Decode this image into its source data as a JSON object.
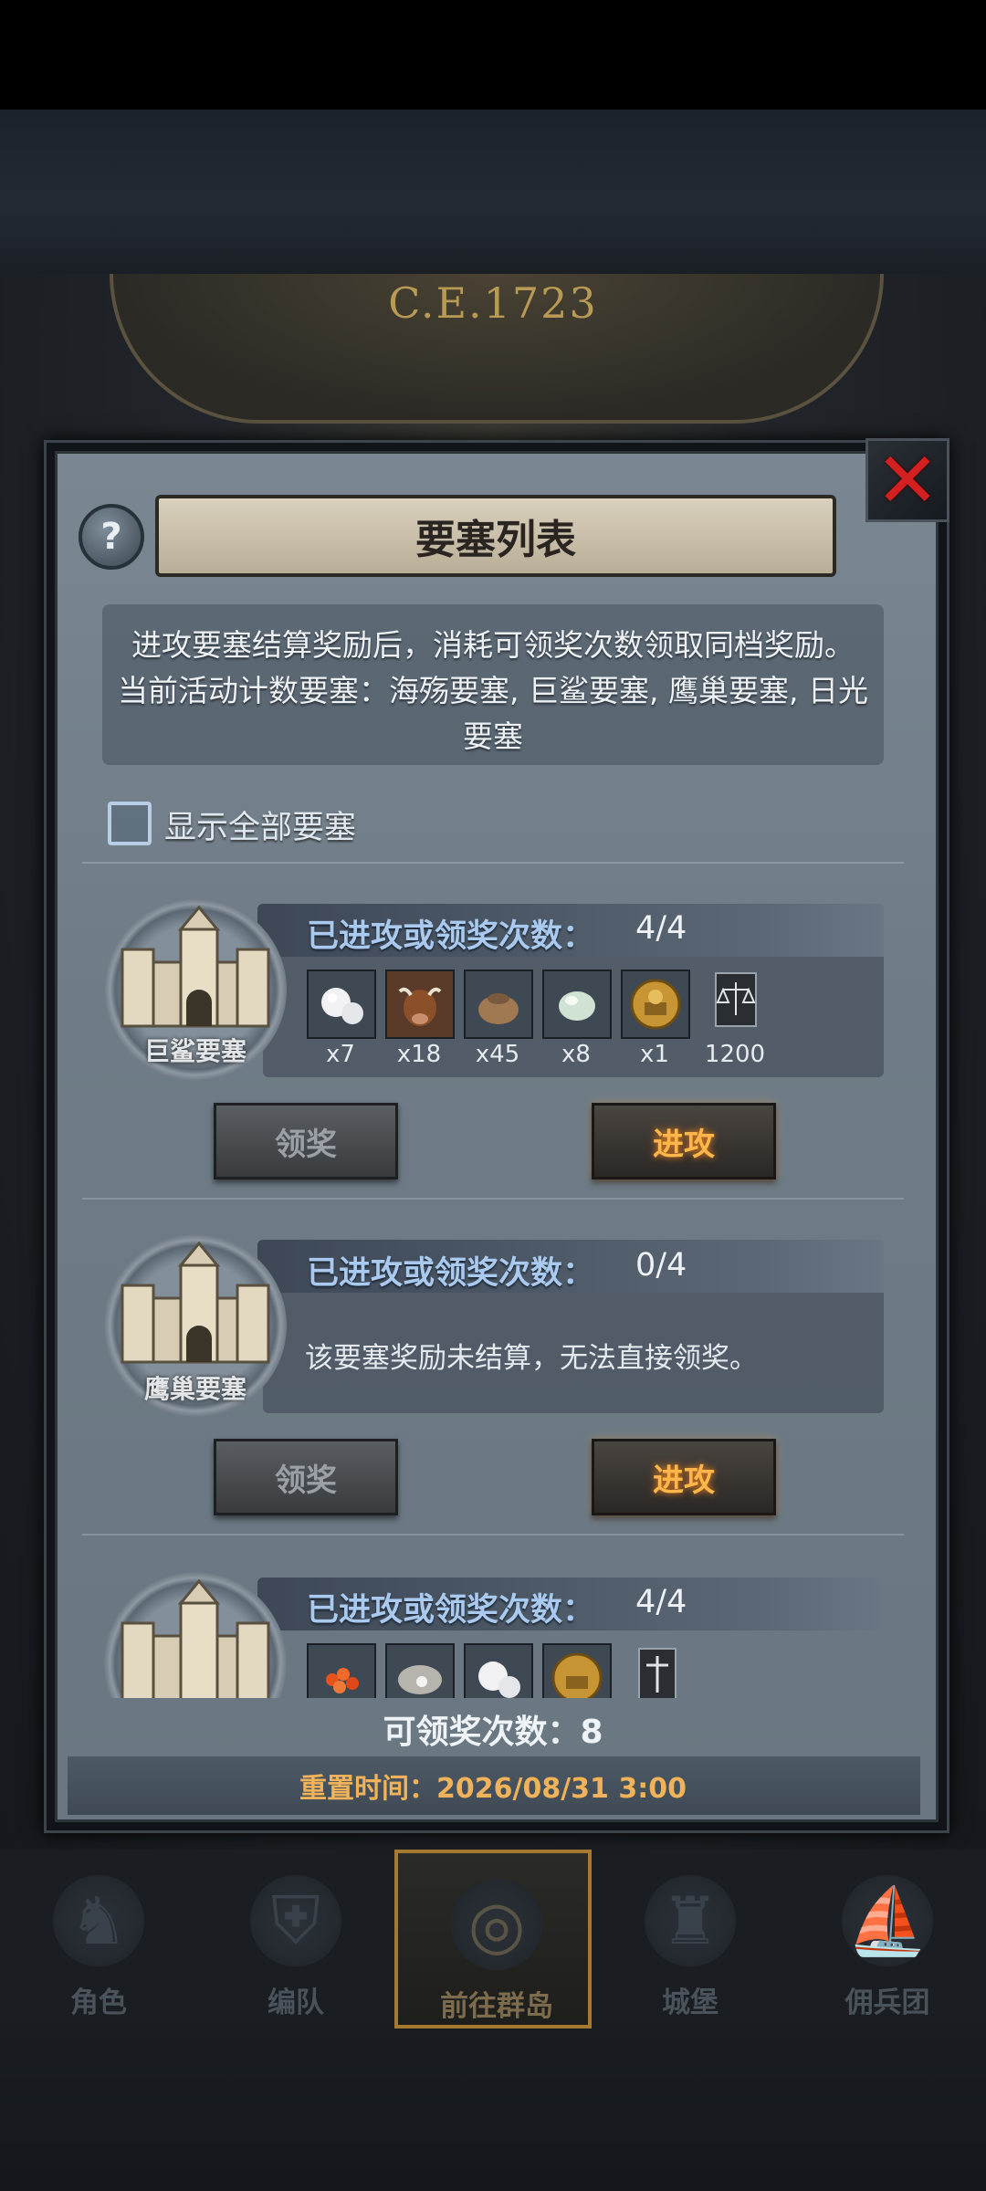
{
  "background": {
    "era_label": "C.E.1723"
  },
  "modal": {
    "title": "要塞列表",
    "help_icon": "?",
    "close_icon": "✕",
    "description": [
      "进攻要塞结算奖励后，消耗可领奖次数领取同档奖励。",
      "当前活动计数要塞：海殇要塞, 巨鲨要塞, 鹰巢要塞, 日光",
      "要塞"
    ],
    "show_all": {
      "label": "显示全部要塞",
      "checked": false
    },
    "fortresses": [
      {
        "name": "巨鲨要塞",
        "count_label": "已进攻或领奖次数：",
        "count_value": "4/4",
        "rewards": [
          {
            "icon": "pearl-icon",
            "qty": "x7"
          },
          {
            "icon": "cattle-icon",
            "qty": "x18"
          },
          {
            "icon": "sack-icon",
            "qty": "x45"
          },
          {
            "icon": "gem-icon",
            "qty": "x8"
          },
          {
            "icon": "gold-helmet-icon",
            "qty": "x1"
          },
          {
            "icon": "fame-scale-icon",
            "qty": "1200"
          }
        ],
        "claim_label": "领奖",
        "attack_label": "进攻"
      },
      {
        "name": "鹰巢要塞",
        "count_label": "已进攻或领奖次数：",
        "count_value": "0/4",
        "message": "该要塞奖励未结算，无法直接领奖。",
        "claim_label": "领奖",
        "attack_label": "进攻"
      },
      {
        "name": "",
        "count_label": "已进攻或领奖次数：",
        "count_value": "4/4",
        "rewards": [
          {
            "icon": "roe-icon"
          },
          {
            "icon": "oyster-icon"
          },
          {
            "icon": "pearl-icon"
          },
          {
            "icon": "gold-helmet-icon"
          },
          {
            "icon": "banner-icon"
          }
        ]
      }
    ],
    "claimable_label": "可领奖次数：8",
    "reset_time": "重置时间：2026/08/31 3:00"
  },
  "nav": [
    {
      "label": "角色",
      "icon": "knight-icon",
      "active": false
    },
    {
      "label": "编队",
      "icon": "helmet-icon",
      "active": false
    },
    {
      "label": "前往群岛",
      "icon": "globe-icon",
      "active": true
    },
    {
      "label": "城堡",
      "icon": "castle-icon",
      "active": false
    },
    {
      "label": "佣兵团",
      "icon": "ship-icon",
      "active": false
    }
  ],
  "colors": {
    "accent_orange": "#ffb64a",
    "header_blue": "#a9c9ee",
    "close_red": "#d42020",
    "reset_gold": "#f0b35a"
  }
}
